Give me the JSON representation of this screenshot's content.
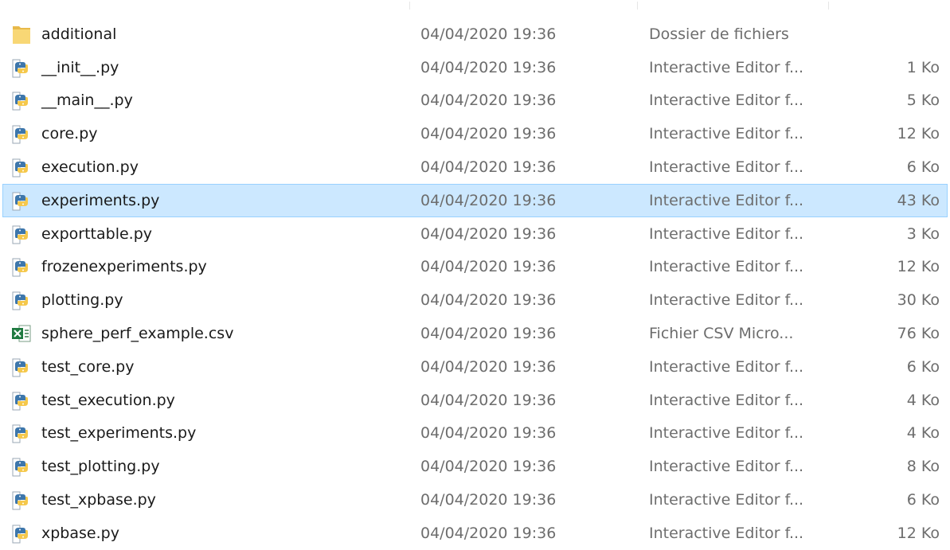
{
  "file_list": {
    "rows": [
      {
        "name": "additional",
        "date": "04/04/2020 19:36",
        "type": "Dossier de fichiers",
        "size": "",
        "icon": "folder-icon",
        "selected": false
      },
      {
        "name": "__init__.py",
        "date": "04/04/2020 19:36",
        "type": "Interactive Editor f...",
        "size": "1 Ko",
        "icon": "python-file-icon",
        "selected": false
      },
      {
        "name": "__main__.py",
        "date": "04/04/2020 19:36",
        "type": "Interactive Editor f...",
        "size": "5 Ko",
        "icon": "python-file-icon",
        "selected": false
      },
      {
        "name": "core.py",
        "date": "04/04/2020 19:36",
        "type": "Interactive Editor f...",
        "size": "12 Ko",
        "icon": "python-file-icon",
        "selected": false
      },
      {
        "name": "execution.py",
        "date": "04/04/2020 19:36",
        "type": "Interactive Editor f...",
        "size": "6 Ko",
        "icon": "python-file-icon",
        "selected": false
      },
      {
        "name": "experiments.py",
        "date": "04/04/2020 19:36",
        "type": "Interactive Editor f...",
        "size": "43 Ko",
        "icon": "python-file-icon",
        "selected": true
      },
      {
        "name": "exporttable.py",
        "date": "04/04/2020 19:36",
        "type": "Interactive Editor f...",
        "size": "3 Ko",
        "icon": "python-file-icon",
        "selected": false
      },
      {
        "name": "frozenexperiments.py",
        "date": "04/04/2020 19:36",
        "type": "Interactive Editor f...",
        "size": "12 Ko",
        "icon": "python-file-icon",
        "selected": false
      },
      {
        "name": "plotting.py",
        "date": "04/04/2020 19:36",
        "type": "Interactive Editor f...",
        "size": "30 Ko",
        "icon": "python-file-icon",
        "selected": false
      },
      {
        "name": "sphere_perf_example.csv",
        "date": "04/04/2020 19:36",
        "type": "Fichier CSV Micro...",
        "size": "76 Ko",
        "icon": "excel-csv-icon",
        "selected": false
      },
      {
        "name": "test_core.py",
        "date": "04/04/2020 19:36",
        "type": "Interactive Editor f...",
        "size": "6 Ko",
        "icon": "python-file-icon",
        "selected": false
      },
      {
        "name": "test_execution.py",
        "date": "04/04/2020 19:36",
        "type": "Interactive Editor f...",
        "size": "4 Ko",
        "icon": "python-file-icon",
        "selected": false
      },
      {
        "name": "test_experiments.py",
        "date": "04/04/2020 19:36",
        "type": "Interactive Editor f...",
        "size": "4 Ko",
        "icon": "python-file-icon",
        "selected": false
      },
      {
        "name": "test_plotting.py",
        "date": "04/04/2020 19:36",
        "type": "Interactive Editor f...",
        "size": "8 Ko",
        "icon": "python-file-icon",
        "selected": false
      },
      {
        "name": "test_xpbase.py",
        "date": "04/04/2020 19:36",
        "type": "Interactive Editor f...",
        "size": "6 Ko",
        "icon": "python-file-icon",
        "selected": false
      },
      {
        "name": "xpbase.py",
        "date": "04/04/2020 19:36",
        "type": "Interactive Editor f...",
        "size": "12 Ko",
        "icon": "python-file-icon",
        "selected": false
      }
    ]
  },
  "colors": {
    "selection_background": "#cce8ff",
    "selection_border": "#99d1ff",
    "secondary_text": "#6d6d6d",
    "primary_text": "#1a1a1a"
  }
}
